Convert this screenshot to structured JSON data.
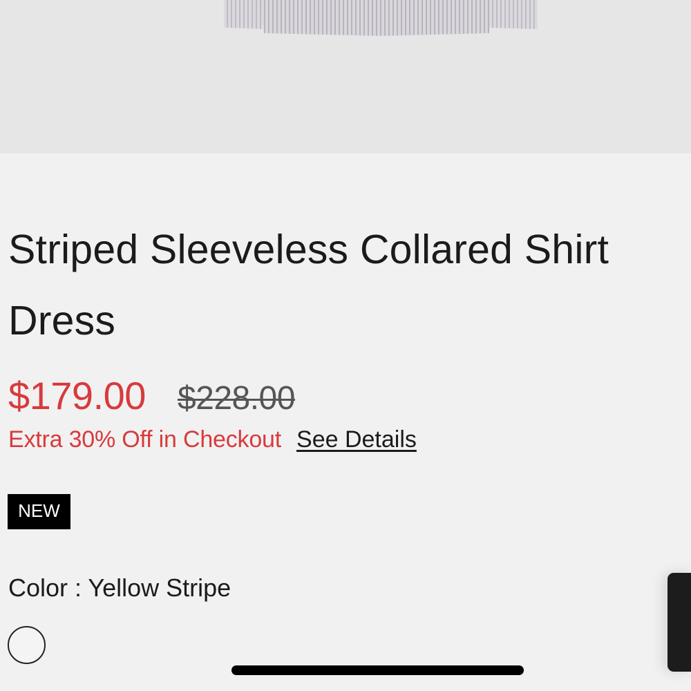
{
  "product": {
    "title": "Striped Sleeveless Collared Shirt Dress",
    "sale_price": "$179.00",
    "original_price": "$228.00",
    "promo_text": "Extra 30% Off in Checkout",
    "see_details_label": "See Details",
    "badge": "NEW",
    "color_line": "Color : Yellow Stripe"
  },
  "colors": {
    "sale_red": "#d83a3c",
    "badge_bg": "#000000",
    "page_bg": "#f1f1f1",
    "hero_bg": "#e6e6e6"
  },
  "icons": {
    "color_swatch": "swatch-circle-icon"
  }
}
